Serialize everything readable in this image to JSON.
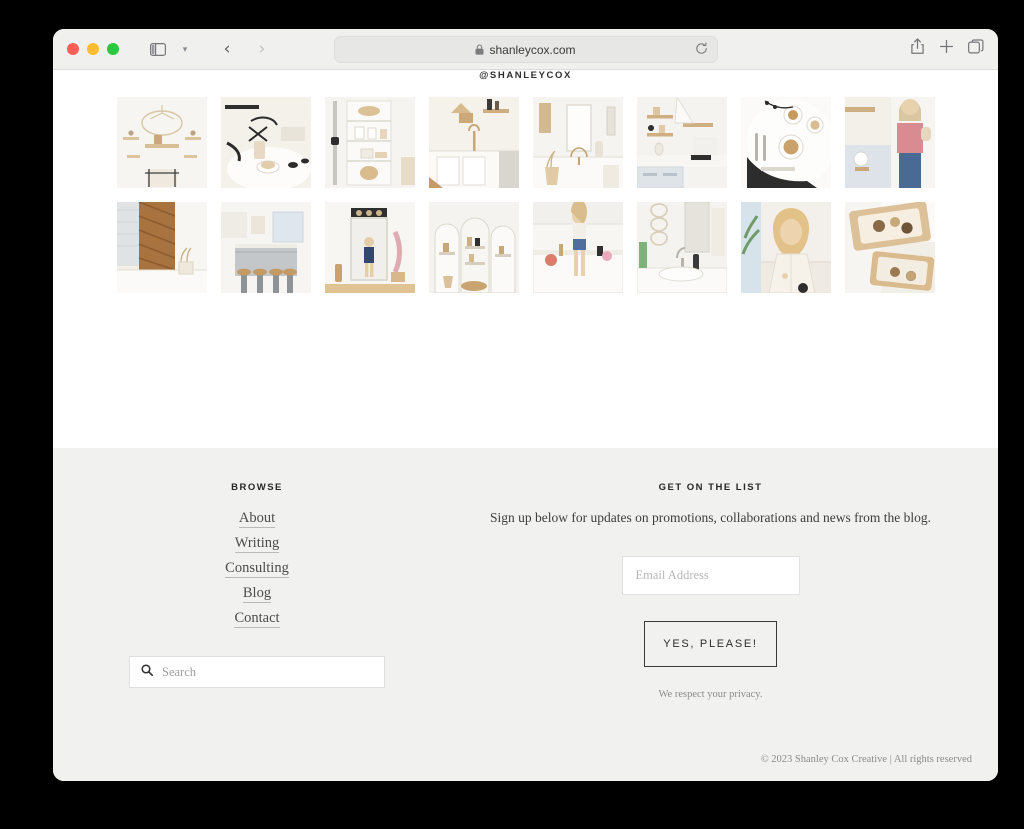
{
  "browser": {
    "url": "shanleycox.com",
    "icons": {
      "lock": "lock-icon",
      "reload": "reload-icon",
      "sidebar": "sidebar-toggle-icon",
      "sidebar_caret": "chevron-down-icon",
      "back": "back-arrow-icon",
      "forward": "forward-arrow-icon",
      "share": "share-icon",
      "new_tab": "plus-icon",
      "tabs": "tab-overview-icon"
    },
    "traffic_lights": [
      "close",
      "minimize",
      "maximize"
    ]
  },
  "instagram": {
    "handle": "@SHANLEYCOX",
    "tiles": [
      {
        "alt": "white kitchen with gold chandelier and open shelving",
        "tone": "#f5f1ec"
      },
      {
        "alt": "round white table with coffee cup and black chairs",
        "tone": "#f2efe9"
      },
      {
        "alt": "white built-in shelving with baskets and ceramics",
        "tone": "#f4f2ee"
      },
      {
        "alt": "bright kitchen with wood accents and pendant light",
        "tone": "#f3f0ea"
      },
      {
        "alt": "white bathroom vanity with mirror and dried florals",
        "tone": "#f4f2ed"
      },
      {
        "alt": "floating wood shelves above blue cabinetry",
        "tone": "#f1f0ec"
      },
      {
        "alt": "flat lay breakfast table with pastry and latte",
        "tone": "#efece6"
      },
      {
        "alt": "woman in pink sweater holding bag in kitchen",
        "tone": "#f2eee8"
      },
      {
        "alt": "wood herringbone accent wall with vase",
        "tone": "#f3efe7"
      },
      {
        "alt": "kitchen island with gray cabinets and stools",
        "tone": "#f1f1ef"
      },
      {
        "alt": "entryway mirror with person reflected",
        "tone": "#f5f3ef"
      },
      {
        "alt": "arched walk-in pantry with shelves",
        "tone": "#f4f1ec"
      },
      {
        "alt": "woman sitting on white kitchen counter",
        "tone": "#f3f0eb"
      },
      {
        "alt": "bathroom sink with macrame wall hanging",
        "tone": "#f2f1ee"
      },
      {
        "alt": "blonde woman in cream blouse on sofa",
        "tone": "#f1eee9"
      },
      {
        "alt": "wood tray with pastries flat lay",
        "tone": "#f2efe8"
      }
    ]
  },
  "footer": {
    "browse": {
      "heading": "BROWSE",
      "links": [
        {
          "label": "About"
        },
        {
          "label": "Writing"
        },
        {
          "label": "Consulting"
        },
        {
          "label": "Blog"
        },
        {
          "label": "Contact"
        }
      ],
      "search": {
        "placeholder": "Search",
        "value": "",
        "icon": "search-icon"
      }
    },
    "newsletter": {
      "heading": "GET ON THE LIST",
      "description": "Sign up below for updates on promotions, collaborations and news from the blog.",
      "email_placeholder": "Email Address",
      "email_value": "",
      "button_label": "YES, PLEASE!",
      "privacy_note": "We respect your privacy."
    },
    "copyright": "© 2023 Shanley Cox Creative  |  All rights reserved"
  },
  "colors": {
    "footer_bg": "#f1f1f0",
    "page_bg": "#ffffff",
    "toolbar_bg": "#f0f0ef",
    "text_dark": "#2b2b2b",
    "text_muted": "#8b8b8b"
  }
}
